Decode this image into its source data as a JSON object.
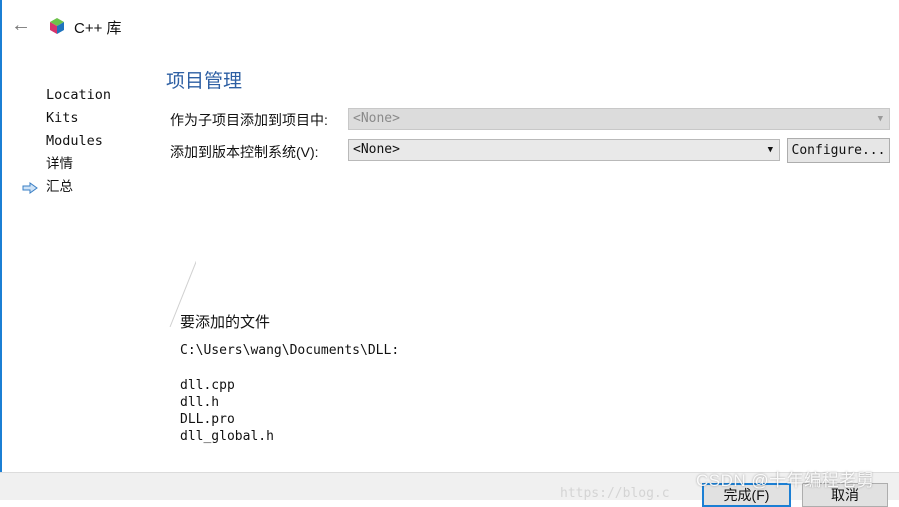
{
  "window": {
    "title": "C++ 库",
    "back_icon": "arrow-left-icon",
    "app_icon": "qt-creator-cube-icon"
  },
  "nav": {
    "items": [
      {
        "label": "Location"
      },
      {
        "label": "Kits"
      },
      {
        "label": "Modules"
      },
      {
        "label": "详情"
      },
      {
        "label": "汇总",
        "current": true
      }
    ]
  },
  "page": {
    "title": "项目管理",
    "add_as_subproject_label": "作为子项目添加到项目中:",
    "add_as_subproject_value": "<None>",
    "vcs_label": "添加到版本控制系统(V):",
    "vcs_value": "<None>",
    "configure_label": "Configure..."
  },
  "files": {
    "heading": "要添加的文件",
    "path": "C:\\Users\\wang\\Documents\\DLL:",
    "list": [
      "dll.cpp",
      "dll.h",
      "DLL.pro",
      "dll_global.h"
    ]
  },
  "footer": {
    "finish_label": "完成(F)",
    "cancel_label": "取消"
  },
  "watermark": {
    "text": "CSDN @十年编程老舅",
    "url_fragment": "https://blog.c"
  },
  "colors": {
    "accent": "#1b7fd4",
    "title": "#2d5fa3"
  }
}
